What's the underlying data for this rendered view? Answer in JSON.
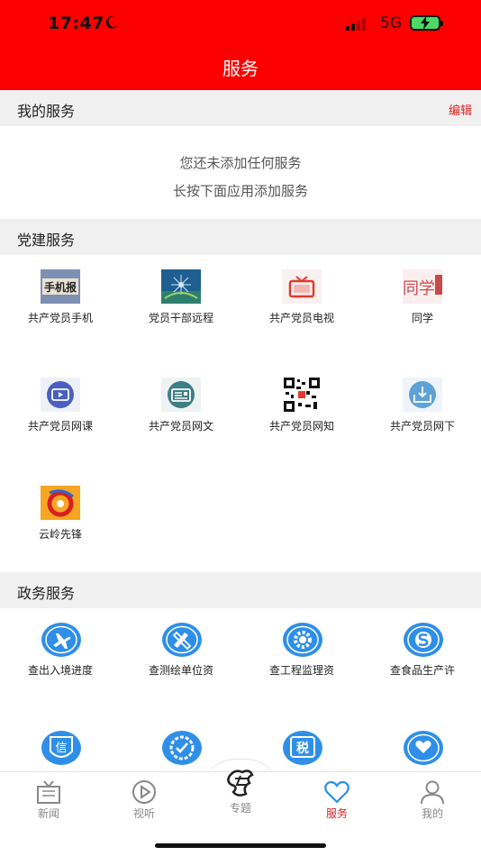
{
  "status": {
    "time": "17:47",
    "network": "5G"
  },
  "header": {
    "title": "服务"
  },
  "my_services": {
    "label": "我的服务",
    "edit": "编辑",
    "empty_line1": "您还未添加任何服务",
    "empty_line2": "长按下面应用添加服务"
  },
  "party": {
    "label": "党建服务",
    "items": [
      {
        "label": "共产党员手机",
        "icon": "phone-news-icon",
        "icon_text": "手机报"
      },
      {
        "label": "党员干部远程",
        "icon": "remote-education-icon"
      },
      {
        "label": "共产党员电视",
        "icon": "tv-icon"
      },
      {
        "label": "同学",
        "icon": "classmate-icon",
        "icon_text": "同学"
      },
      {
        "label": "共产党员网课",
        "icon": "video-course-icon"
      },
      {
        "label": "共产党员网文",
        "icon": "article-icon"
      },
      {
        "label": "共产党员网知",
        "icon": "qr-code-icon"
      },
      {
        "label": "共产党员网下",
        "icon": "download-icon"
      },
      {
        "label": "云岭先锋",
        "icon": "yunling-logo-icon"
      }
    ]
  },
  "gov": {
    "label": "政务服务",
    "items": [
      {
        "label": "查出入境进度",
        "icon": "airplane-icon"
      },
      {
        "label": "查测绘单位资",
        "icon": "ruler-pencil-icon"
      },
      {
        "label": "查工程监理资",
        "icon": "gear-icon"
      },
      {
        "label": "查食品生产许",
        "icon": "food-license-icon"
      },
      {
        "label": "",
        "icon": "credit-icon",
        "icon_text": "信"
      },
      {
        "label": "",
        "icon": "check-gear-icon"
      },
      {
        "label": "",
        "icon": "tax-icon",
        "icon_text": "税"
      },
      {
        "label": "",
        "icon": "heart-hands-icon"
      }
    ]
  },
  "tabs": [
    {
      "label": "新闻",
      "icon": "news-icon"
    },
    {
      "label": "视听",
      "icon": "play-icon"
    },
    {
      "label": "专题",
      "icon": "special-topic-icon"
    },
    {
      "label": "服务",
      "icon": "heart-icon",
      "active": true
    },
    {
      "label": "我的",
      "icon": "person-icon"
    }
  ],
  "colors": {
    "brand_red": "#fc0000",
    "accent_blue": "#2f8fe8",
    "active_tab": "#e02020"
  }
}
